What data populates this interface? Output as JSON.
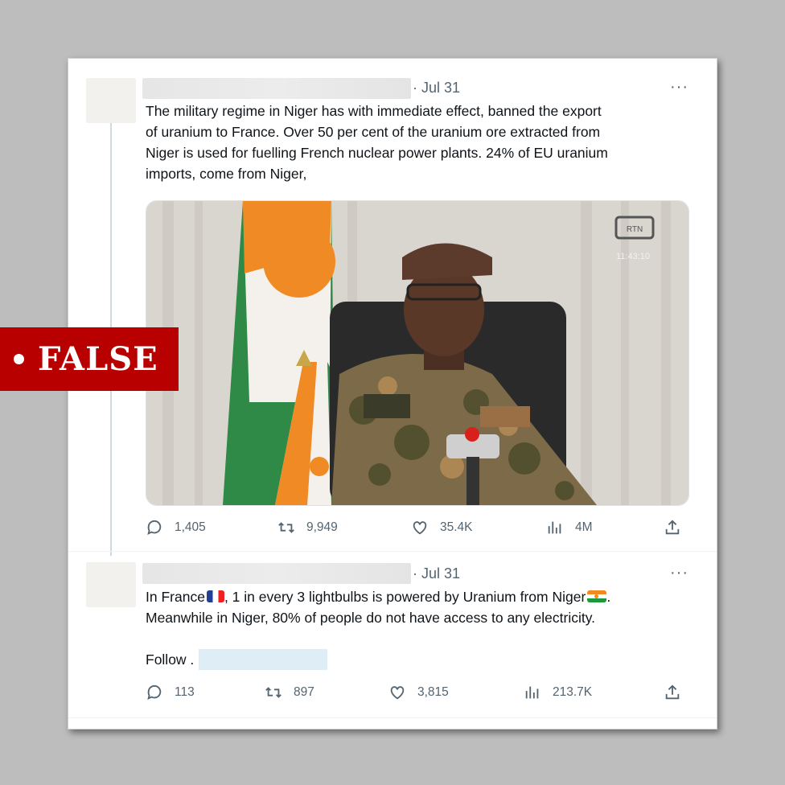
{
  "badge": {
    "label": "FALSE"
  },
  "tweets": [
    {
      "date": "· Jul 31",
      "more": "···",
      "text_lines": [
        "The military regime in Niger has with immediate effect, banned the export",
        "of uranium to France. Over 50 per cent of the uranium ore extracted from",
        "Niger is used for fuelling French nuclear power plants. 24% of EU uranium",
        "imports, come from Niger,"
      ],
      "media": {
        "channel_logo": "RTN",
        "time": "11:43:10"
      },
      "stats": {
        "replies": "1,405",
        "retweets": "9,949",
        "likes": "35.4K",
        "views": "4M"
      }
    },
    {
      "date": "· Jul 31",
      "more": "···",
      "line1_a": "In France",
      "line1_b": ", 1 in every 3 lightbulbs is powered by Uranium from Niger",
      "line1_c": ".",
      "line2": "Meanwhile in Niger, 80% of people do not have access to any electricity.",
      "follow": "Follow .",
      "stats": {
        "replies": "113",
        "retweets": "897",
        "likes": "3,815",
        "views": "213.7K"
      }
    }
  ],
  "icons": [
    "reply-icon",
    "retweet-icon",
    "like-icon",
    "views-icon",
    "share-icon"
  ],
  "colors": {
    "badge": "#b80000",
    "text": "#0f1419",
    "muted": "#536471"
  }
}
